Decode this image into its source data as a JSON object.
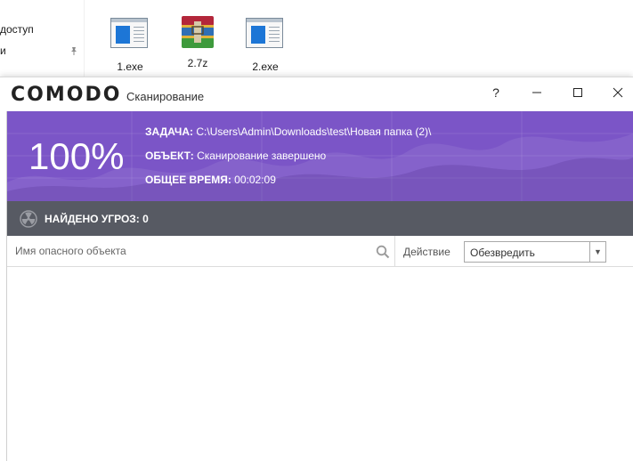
{
  "explorer": {
    "nav_items": [
      "доступ",
      "и"
    ],
    "files": [
      {
        "name": "1.exe",
        "icon": "exe-file-icon"
      },
      {
        "name": "2.7z",
        "icon": "winrar-archive-icon"
      },
      {
        "name": "2.exe",
        "icon": "exe-file-icon"
      }
    ]
  },
  "window": {
    "logo": "COMODO",
    "title": "Сканирование",
    "help": "?",
    "minimize": "—",
    "maximize": "☐",
    "close": "✕"
  },
  "scan": {
    "percent": "100%",
    "task_label": "ЗАДАЧА:",
    "task_value": " C:\\Users\\Admin\\Downloads\\test\\Новая папка (2)\\",
    "object_label": "ОБЪЕКТ:",
    "object_value": " Сканирование завершено",
    "time_label": "ОБЩЕЕ ВРЕМЯ:",
    "time_value": " 00:02:09",
    "progress": 1.0
  },
  "threats": {
    "label": "НАЙДЕНО УГРОЗ:",
    "count": "0"
  },
  "filter": {
    "search_placeholder": "Имя опасного объекта",
    "action_label": "Действие",
    "action_selected": "Обезвредить",
    "arrow": "▼"
  },
  "colors": {
    "banner": "#7b55c7",
    "threat_bar": "#575a63"
  }
}
